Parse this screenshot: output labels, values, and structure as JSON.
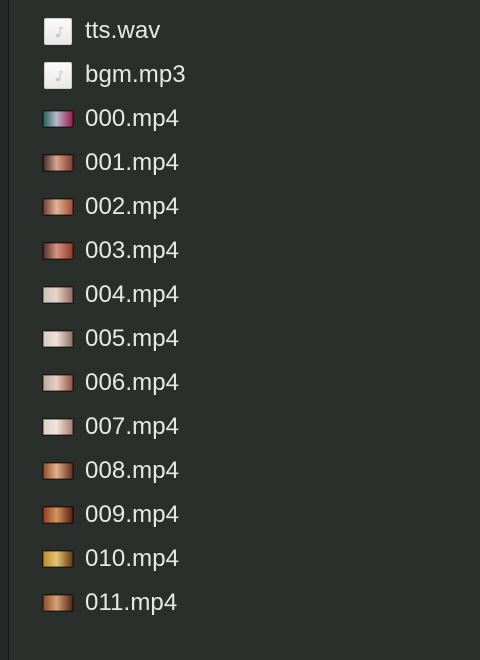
{
  "files": [
    {
      "name": "tts.wav",
      "kind": "audio",
      "icon": "audio-file-icon"
    },
    {
      "name": "bgm.mp3",
      "kind": "audio",
      "icon": "audio-file-icon"
    },
    {
      "name": "000.mp4",
      "kind": "video",
      "icon": "video-thumbnail-icon",
      "colors": [
        "#1f5f54",
        "#b8b8c8",
        "#9b1b4d"
      ]
    },
    {
      "name": "001.mp4",
      "kind": "video",
      "icon": "video-thumbnail-icon",
      "colors": [
        "#3a2a26",
        "#d9a48e",
        "#7a3b2e"
      ]
    },
    {
      "name": "002.mp4",
      "kind": "video",
      "icon": "video-thumbnail-icon",
      "colors": [
        "#6e3a2b",
        "#e0b39b",
        "#a44a34"
      ]
    },
    {
      "name": "003.mp4",
      "kind": "video",
      "icon": "video-thumbnail-icon",
      "colors": [
        "#4d2a25",
        "#d59481",
        "#8c3b2c"
      ]
    },
    {
      "name": "004.mp4",
      "kind": "video",
      "icon": "video-thumbnail-icon",
      "colors": [
        "#c9c2bc",
        "#e8d3c8",
        "#8f6a5c"
      ]
    },
    {
      "name": "005.mp4",
      "kind": "video",
      "icon": "video-thumbnail-icon",
      "colors": [
        "#d3cbc4",
        "#f0e2d8",
        "#8b6e60"
      ]
    },
    {
      "name": "006.mp4",
      "kind": "video",
      "icon": "video-thumbnail-icon",
      "colors": [
        "#b9a8a0",
        "#e9cfc2",
        "#8e4f3d"
      ]
    },
    {
      "name": "007.mp4",
      "kind": "video",
      "icon": "video-thumbnail-icon",
      "colors": [
        "#d9d0c9",
        "#f1e5dc",
        "#a57e6c"
      ]
    },
    {
      "name": "008.mp4",
      "kind": "video",
      "icon": "video-thumbnail-icon",
      "colors": [
        "#8b4a2a",
        "#e3b18a",
        "#5e2c1c"
      ]
    },
    {
      "name": "009.mp4",
      "kind": "video",
      "icon": "video-thumbnail-icon",
      "colors": [
        "#8e3a22",
        "#d9935c",
        "#4e1c12"
      ]
    },
    {
      "name": "010.mp4",
      "kind": "video",
      "icon": "video-thumbnail-icon",
      "colors": [
        "#b88a2c",
        "#e6c46f",
        "#5b3818"
      ]
    },
    {
      "name": "011.mp4",
      "kind": "video",
      "icon": "video-thumbnail-icon",
      "colors": [
        "#8a4a2a",
        "#d9a177",
        "#4a2415"
      ]
    }
  ]
}
